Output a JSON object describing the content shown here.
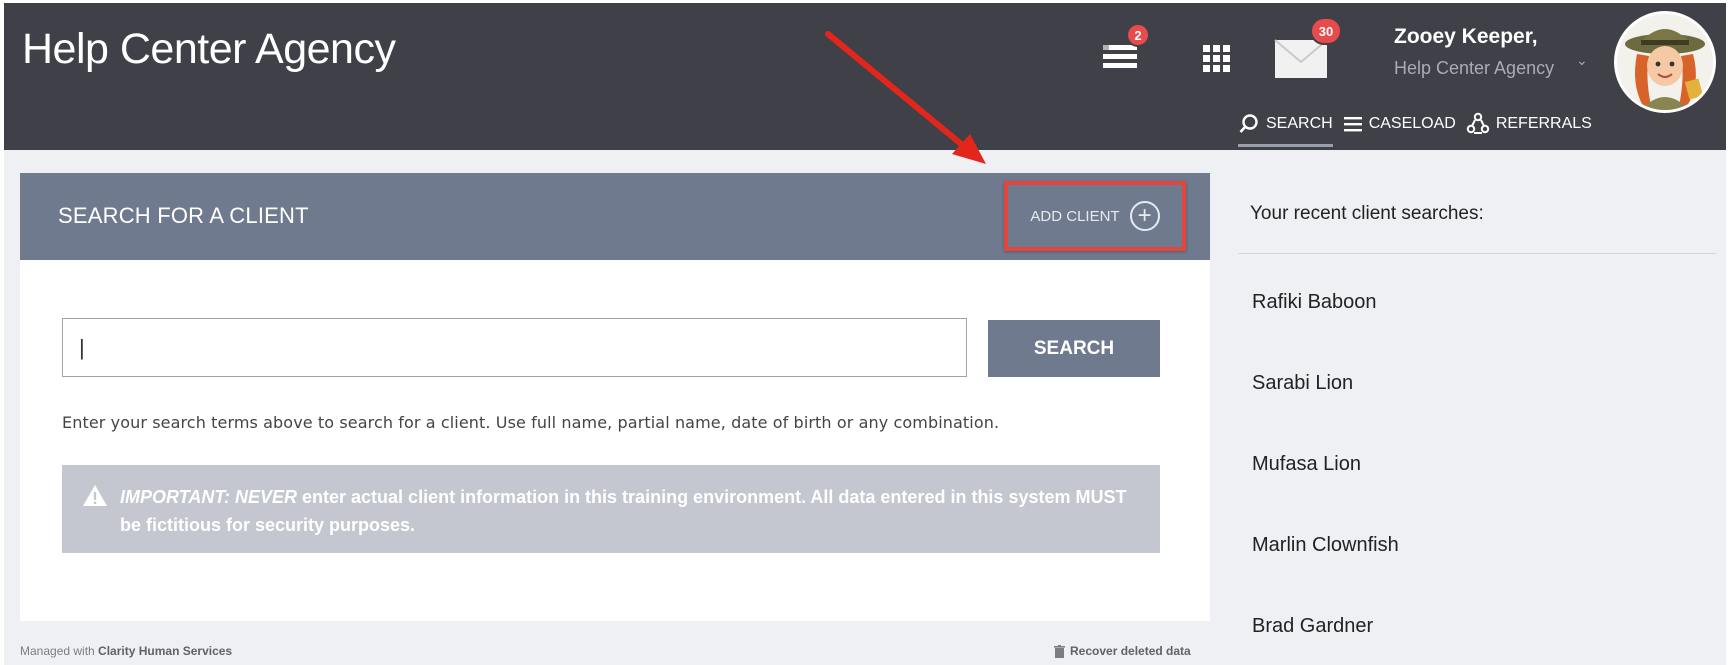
{
  "header": {
    "title": "Help Center Agency",
    "notifications_count": "2",
    "messages_count": "30",
    "user_name": "Zooey Keeper,",
    "user_org": "Help Center Agency"
  },
  "nav": [
    {
      "label": "SEARCH",
      "icon": "search-icon"
    },
    {
      "label": "CASELOAD",
      "icon": "list-icon"
    },
    {
      "label": "REFERRALS",
      "icon": "referrals-icon"
    }
  ],
  "search_card": {
    "title": "SEARCH FOR A CLIENT",
    "add_client_label": "ADD CLIENT",
    "input_value": "|",
    "search_button": "SEARCH",
    "help_text": "Enter your search terms above to search for a client. Use full name, partial name, date of birth or any combination.",
    "warning_lead": "IMPORTANT: NEVER",
    "warning_rest": " enter actual client information in this training environment. All data entered in this system MUST be fictitious for security purposes."
  },
  "footer": {
    "managed_prefix": "Managed with ",
    "managed_brand": "Clarity Human Services",
    "recover_label": "Recover deleted data"
  },
  "recent": {
    "title": "Your recent client searches:",
    "items": [
      "Rafiki Baboon",
      "Sarabi Lion",
      "Mufasa Lion",
      "Marlin Clownfish",
      "Brad Gardner"
    ]
  },
  "colors": {
    "header_bg": "#3f4048",
    "card_header_bg": "#6f7a8e",
    "highlight_red": "#e2463d",
    "badge_red": "#e84b4b",
    "warning_bg": "#c4c7cf"
  }
}
